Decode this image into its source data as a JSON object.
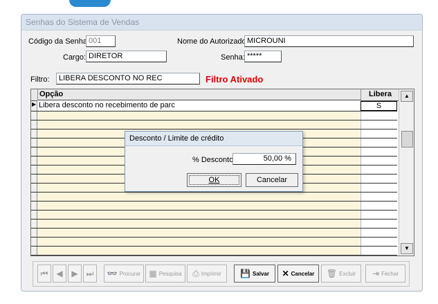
{
  "window": {
    "title": "Senhas do Sistema de Vendas"
  },
  "form": {
    "codigo_label": "Código da Senha:",
    "codigo_value": "001",
    "autorizado_label": "Nome do Autorizado:",
    "autorizado_value": "MICROUNI",
    "cargo_label": "Cargo:",
    "cargo_value": "DIRETOR",
    "senha_label": "Senha:",
    "senha_value": "*****"
  },
  "filter": {
    "label": "Filtro:",
    "value": "LIBERA DESCONTO NO REC",
    "status": "Filtro Ativado",
    "status_color": "#e00000"
  },
  "grid": {
    "columns": [
      "Opção",
      "Libera"
    ],
    "rows": [
      {
        "opcao": "Libera desconto no recebimento de parc",
        "libera": "S"
      }
    ]
  },
  "dialog": {
    "title": "Desconto / Limite de crédito",
    "field_label": "% Desconto",
    "field_value": "50,00 %",
    "ok_label": "OK",
    "cancel_label": "Cancelar"
  },
  "toolbar": {
    "first_icon": "first-record-icon",
    "prev_icon": "previous-record-icon",
    "next_icon": "next-record-icon",
    "last_icon": "last-record-icon",
    "procurar": "Procurar",
    "pesquisa": "Pesquisa",
    "imprimir": "Imprimir",
    "salvar": "Salvar",
    "cancelar": "Cancelar",
    "excluir": "Excluir",
    "fechar": "Fechar"
  }
}
